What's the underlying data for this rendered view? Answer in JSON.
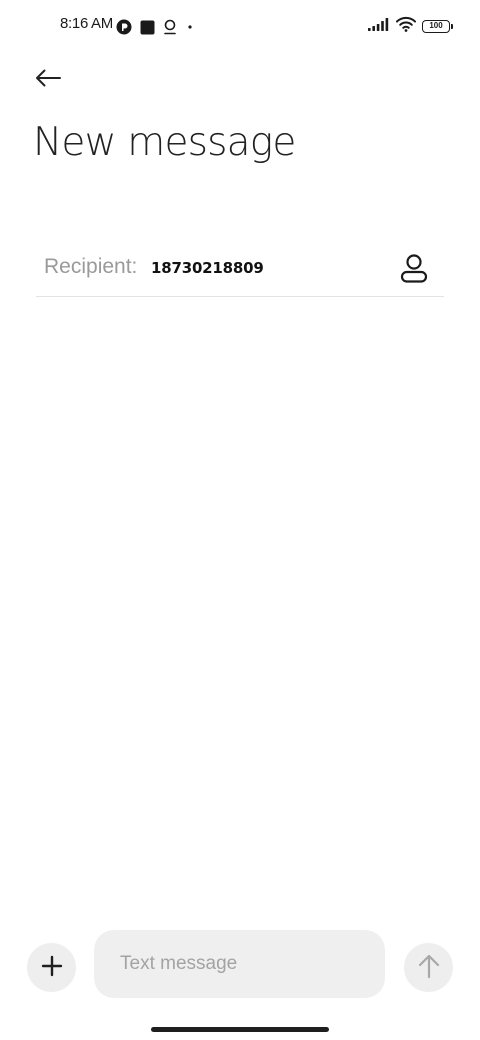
{
  "status_bar": {
    "time": "8:16 AM",
    "battery": "100"
  },
  "header": {
    "title": "New message"
  },
  "recipient": {
    "label": "Recipient:",
    "value": "18730218809"
  },
  "composer": {
    "placeholder": "Text message"
  },
  "icons": {
    "back": "arrow-left-icon",
    "contact": "person-icon",
    "add": "plus-icon",
    "send": "arrow-up-icon"
  },
  "colors": {
    "background": "#ffffff",
    "title_text": "#222222",
    "label_text": "#9a9a9a",
    "control_bg": "#eeeeee",
    "divider": "#e3e3e3"
  }
}
